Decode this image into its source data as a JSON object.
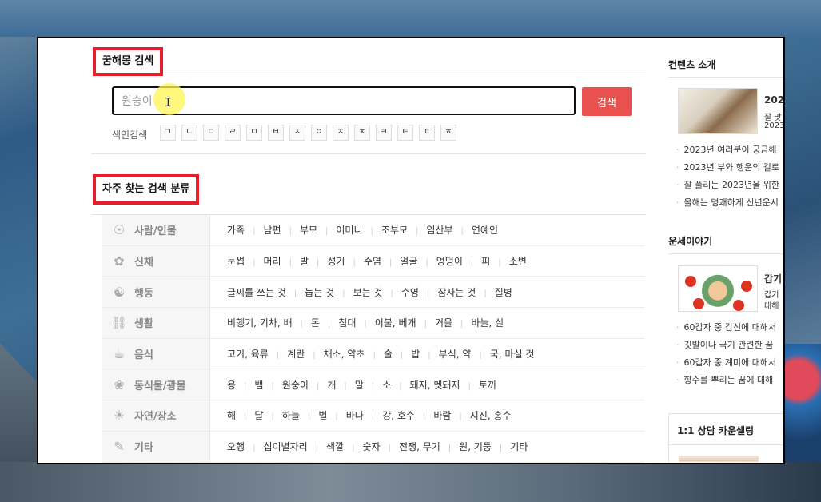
{
  "dream_search": {
    "title": "꿈해몽 검색",
    "query": "원숭이",
    "search_button": "검색",
    "index_label": "색인검색",
    "index_keys": [
      "ㄱ",
      "ㄴ",
      "ㄷ",
      "ㄹ",
      "ㅁ",
      "ㅂ",
      "ㅅ",
      "ㅇ",
      "ㅈ",
      "ㅊ",
      "ㅋ",
      "ㅌ",
      "ㅍ",
      "ㅎ"
    ]
  },
  "categories": {
    "title": "자주 찾는 검색 분류",
    "rows": [
      {
        "icon": "person-icon",
        "name": "사람/인물",
        "items": [
          "가족",
          "남편",
          "부모",
          "어머니",
          "조부모",
          "임산부",
          "연예인"
        ]
      },
      {
        "icon": "body-icon",
        "name": "신체",
        "items": [
          "눈썹",
          "머리",
          "발",
          "성기",
          "수염",
          "얼굴",
          "엉덩이",
          "피",
          "소변"
        ]
      },
      {
        "icon": "action-icon",
        "name": "행동",
        "items": [
          "글씨를 쓰는 것",
          "눕는 것",
          "보는 것",
          "수영",
          "잠자는 것",
          "질병"
        ]
      },
      {
        "icon": "car-icon",
        "name": "생활",
        "items": [
          "비행기, 기차, 배",
          "돈",
          "침대",
          "이불, 베개",
          "거울",
          "바늘, 실"
        ]
      },
      {
        "icon": "food-icon",
        "name": "음식",
        "items": [
          "고기, 육류",
          "계란",
          "채소, 약초",
          "술",
          "밥",
          "부식, 약",
          "국, 마실 것"
        ]
      },
      {
        "icon": "plant-icon",
        "name": "동식물/광물",
        "items": [
          "용",
          "뱀",
          "원숭이",
          "개",
          "말",
          "소",
          "돼지, 멧돼지",
          "토끼"
        ]
      },
      {
        "icon": "weather-icon",
        "name": "자연/장소",
        "items": [
          "해",
          "달",
          "하늘",
          "별",
          "바다",
          "강, 호수",
          "바람",
          "지진, 홍수"
        ]
      },
      {
        "icon": "scroll-icon",
        "name": "기타",
        "items": [
          "오행",
          "십이별자리",
          "색깔",
          "숫자",
          "전쟁, 무기",
          "원, 기둥",
          "기타"
        ]
      }
    ]
  },
  "sidebar": {
    "contents_title": "컨텐츠 소개",
    "feature": {
      "title": "202",
      "line1": "잘 맞",
      "line2": "2023"
    },
    "contents_links": [
      "2023년 여러분이 궁금해",
      "2023년 부와 행운의 길로",
      "잘 풀리는 2023년을 위한",
      "올해는 명쾌하게 신년운시"
    ],
    "fortune_title": "운세이야기",
    "fortune_feature": {
      "title": "갑기",
      "line1": "갑기",
      "line2": "대해"
    },
    "fortune_links": [
      "60갑자 중 갑신에 대해서",
      "깃발이나 국기 관련한 꿈",
      "60갑자 중 계미에 대해서",
      "향수를 뿌리는 꿈에 대해"
    ],
    "counsel_title": "1:1 상담 카운셀링"
  }
}
